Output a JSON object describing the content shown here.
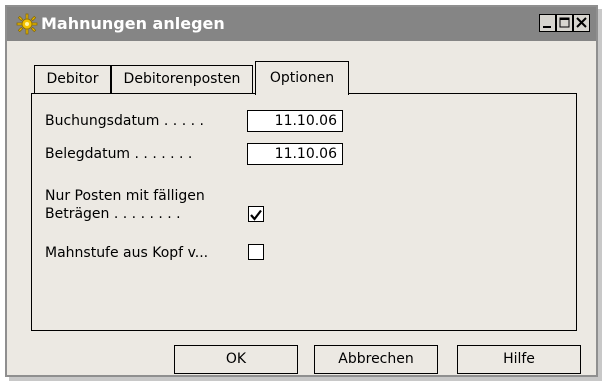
{
  "window": {
    "title": "Mahnungen anlegen",
    "controls": [
      "minimize-icon",
      "maximize-icon",
      "close-icon"
    ]
  },
  "tabs": [
    {
      "label": "Debitor",
      "active": false
    },
    {
      "label": "Debitorenposten",
      "active": false
    },
    {
      "label": "Optionen",
      "active": true
    }
  ],
  "options": {
    "buchungsdatum": {
      "label": "Buchungsdatum . . . . .",
      "value": "11.10.06"
    },
    "belegdatum": {
      "label": "Belegdatum . . . . . . .",
      "value": "11.10.06"
    },
    "nur_posten": {
      "label_line1": "Nur Posten mit fälligen",
      "label_line2": "Beträgen . . . . . . . .",
      "checked": true
    },
    "mahnstufe": {
      "label": "Mahnstufe aus Kopf v...",
      "checked": false
    }
  },
  "buttons": {
    "ok": "OK",
    "cancel": "Abbrechen",
    "help": "Hilfe"
  },
  "colors": {
    "titlebar": "#858585",
    "window_bg": "#ece9e3",
    "icon_sun": "#f2c200"
  }
}
